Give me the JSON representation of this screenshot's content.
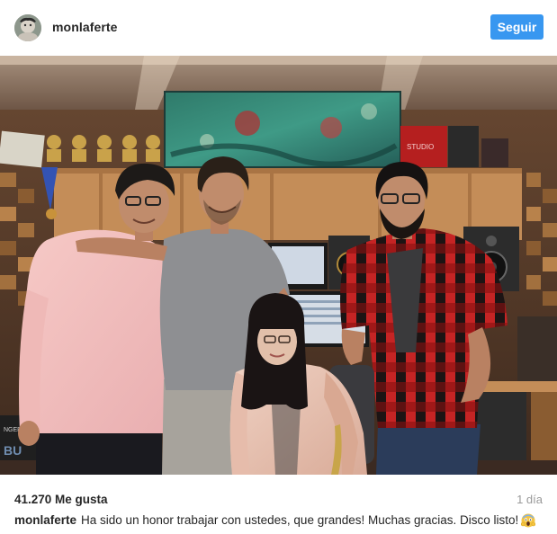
{
  "post": {
    "username": "monlaferte",
    "follow_label": "Seguir",
    "likes": "41.270 Me gusta",
    "time_ago": "1 día",
    "caption": {
      "username": "monlaferte",
      "text": "Ha sido un honor trabajar con ustedes, que grandes! Muchas gracias. Disco listo!",
      "emoji_icon": "face-screaming-in-fear-icon"
    },
    "photo": {
      "icon": "studio-group-photo",
      "amp_label_1": "BU",
      "amp_label_2": "NGER",
      "rack_label": "STUDIO"
    }
  },
  "colors": {
    "follow_button": "#3897f0",
    "text": "#262626",
    "muted": "#999999"
  }
}
